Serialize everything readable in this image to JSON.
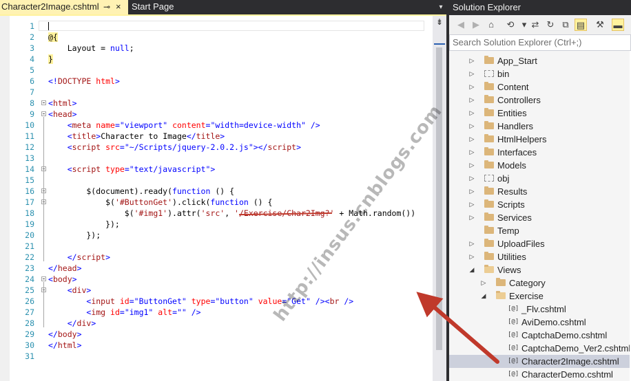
{
  "editor": {
    "tabs": [
      {
        "label": "Character2Image.cshtml",
        "pin": "⊸",
        "close": "×"
      },
      {
        "label": "Start Page"
      }
    ],
    "tab_menu": "▾",
    "split": "⇟"
  },
  "code": {
    "line_numbers": [
      "1",
      "2",
      "3",
      "4",
      "5",
      "6",
      "7",
      "8",
      "9",
      "10",
      "11",
      "12",
      "13",
      "14",
      "15",
      "16",
      "17",
      "18",
      "19",
      "20",
      "21",
      "22",
      "23",
      "24",
      "25",
      "26",
      "27",
      "28",
      "29",
      "30",
      "31"
    ],
    "lines": [
      [],
      [
        {
          "t": "@{",
          "c": "hl"
        }
      ],
      [
        {
          "t": "    Layout = ",
          "c": "black"
        },
        {
          "t": "null",
          "c": "blue"
        },
        {
          "t": ";",
          "c": "black"
        }
      ],
      [
        {
          "t": "}",
          "c": "hl"
        }
      ],
      [],
      [
        {
          "t": "<!",
          "c": "blue"
        },
        {
          "t": "DOCTYPE",
          "c": "maroon"
        },
        {
          "t": " ",
          "c": "black"
        },
        {
          "t": "html",
          "c": "red"
        },
        {
          "t": ">",
          "c": "blue"
        }
      ],
      [],
      [
        {
          "t": "<",
          "c": "blue"
        },
        {
          "t": "html",
          "c": "maroon"
        },
        {
          "t": ">",
          "c": "blue"
        }
      ],
      [
        {
          "t": "<",
          "c": "blue"
        },
        {
          "t": "head",
          "c": "maroon"
        },
        {
          "t": ">",
          "c": "blue"
        }
      ],
      [
        {
          "t": "    <",
          "c": "blue"
        },
        {
          "t": "meta",
          "c": "maroon"
        },
        {
          "t": " ",
          "c": "black"
        },
        {
          "t": "name",
          "c": "red"
        },
        {
          "t": "=\"viewport\" ",
          "c": "blue"
        },
        {
          "t": "content",
          "c": "red"
        },
        {
          "t": "=\"width=device-width\" />",
          "c": "blue"
        }
      ],
      [
        {
          "t": "    <",
          "c": "blue"
        },
        {
          "t": "title",
          "c": "maroon"
        },
        {
          "t": ">",
          "c": "blue"
        },
        {
          "t": "Character to Image",
          "c": "black"
        },
        {
          "t": "</",
          "c": "blue"
        },
        {
          "t": "title",
          "c": "maroon"
        },
        {
          "t": ">",
          "c": "blue"
        }
      ],
      [
        {
          "t": "    <",
          "c": "blue"
        },
        {
          "t": "script",
          "c": "maroon"
        },
        {
          "t": " ",
          "c": "black"
        },
        {
          "t": "src",
          "c": "red"
        },
        {
          "t": "=\"~/Scripts/jquery-2.0.2.js\"></",
          "c": "blue"
        },
        {
          "t": "script",
          "c": "maroon"
        },
        {
          "t": ">",
          "c": "blue"
        }
      ],
      [],
      [
        {
          "t": "    <",
          "c": "blue"
        },
        {
          "t": "script",
          "c": "maroon"
        },
        {
          "t": " ",
          "c": "black"
        },
        {
          "t": "type",
          "c": "red"
        },
        {
          "t": "=\"text/javascript\">",
          "c": "blue"
        }
      ],
      [],
      [
        {
          "t": "        $(document).ready(",
          "c": "black"
        },
        {
          "t": "function",
          "c": "blue"
        },
        {
          "t": " () {",
          "c": "black"
        }
      ],
      [
        {
          "t": "            $(",
          "c": "black"
        },
        {
          "t": "'#ButtonGet'",
          "c": "maroon"
        },
        {
          "t": ").click(",
          "c": "black"
        },
        {
          "t": "function",
          "c": "blue"
        },
        {
          "t": " () {",
          "c": "black"
        }
      ],
      [
        {
          "t": "                $(",
          "c": "black"
        },
        {
          "t": "'#img1'",
          "c": "maroon"
        },
        {
          "t": ").attr(",
          "c": "black"
        },
        {
          "t": "'src'",
          "c": "maroon"
        },
        {
          "t": ", ",
          "c": "black"
        },
        {
          "t": "'/Exercise/Char2Img?'",
          "c": "maroon"
        },
        {
          "t": " + Math.random())",
          "c": "black"
        }
      ],
      [
        {
          "t": "            });",
          "c": "black"
        }
      ],
      [
        {
          "t": "        });",
          "c": "black"
        }
      ],
      [],
      [
        {
          "t": "    </",
          "c": "blue"
        },
        {
          "t": "script",
          "c": "maroon"
        },
        {
          "t": ">",
          "c": "blue"
        }
      ],
      [
        {
          "t": "</",
          "c": "blue"
        },
        {
          "t": "head",
          "c": "maroon"
        },
        {
          "t": ">",
          "c": "blue"
        }
      ],
      [
        {
          "t": "<",
          "c": "blue"
        },
        {
          "t": "body",
          "c": "maroon"
        },
        {
          "t": ">",
          "c": "blue"
        }
      ],
      [
        {
          "t": "    <",
          "c": "blue"
        },
        {
          "t": "div",
          "c": "maroon"
        },
        {
          "t": ">",
          "c": "blue"
        }
      ],
      [
        {
          "t": "        <",
          "c": "blue"
        },
        {
          "t": "input",
          "c": "maroon"
        },
        {
          "t": " ",
          "c": "black"
        },
        {
          "t": "id",
          "c": "red"
        },
        {
          "t": "=\"ButtonGet\" ",
          "c": "blue"
        },
        {
          "t": "type",
          "c": "red"
        },
        {
          "t": "=\"button\" ",
          "c": "blue"
        },
        {
          "t": "value",
          "c": "red"
        },
        {
          "t": "=\"Get\" />",
          "c": "blue"
        },
        {
          "t": "<",
          "c": "blue"
        },
        {
          "t": "br",
          "c": "maroon"
        },
        {
          "t": " />",
          "c": "blue"
        }
      ],
      [
        {
          "t": "        <",
          "c": "blue"
        },
        {
          "t": "img",
          "c": "maroon"
        },
        {
          "t": " ",
          "c": "black"
        },
        {
          "t": "id",
          "c": "red"
        },
        {
          "t": "=\"img1\" ",
          "c": "blue"
        },
        {
          "t": "alt",
          "c": "red"
        },
        {
          "t": "=\"\" />",
          "c": "blue"
        }
      ],
      [
        {
          "t": "    </",
          "c": "blue"
        },
        {
          "t": "div",
          "c": "maroon"
        },
        {
          "t": ">",
          "c": "blue"
        }
      ],
      [
        {
          "t": "</",
          "c": "blue"
        },
        {
          "t": "body",
          "c": "maroon"
        },
        {
          "t": ">",
          "c": "blue"
        }
      ],
      [
        {
          "t": "</",
          "c": "blue"
        },
        {
          "t": "html",
          "c": "maroon"
        },
        {
          "t": ">",
          "c": "blue"
        }
      ],
      []
    ],
    "fold_lines": [
      8,
      9,
      14,
      16,
      17,
      24,
      25
    ]
  },
  "watermark": "http://insus.cnblogs.com",
  "solution_explorer": {
    "title": "Solution Explorer",
    "search_placeholder": "Search Solution Explorer (Ctrl+;)",
    "toolbar_icons": [
      {
        "name": "back-icon",
        "glyph": "◀",
        "state": "dim"
      },
      {
        "name": "forward-icon",
        "glyph": "▶",
        "state": "dim"
      },
      {
        "name": "home-icon",
        "glyph": "⌂",
        "state": ""
      },
      {
        "name": "history-icon",
        "glyph": "⟲",
        "state": ""
      },
      {
        "name": "dropdown-icon",
        "glyph": "▾",
        "state": ""
      },
      {
        "name": "sync-icon",
        "glyph": "⇄",
        "state": ""
      },
      {
        "name": "refresh-icon",
        "glyph": "↻",
        "state": ""
      },
      {
        "name": "collapse-all-icon",
        "glyph": "⧉",
        "state": ""
      },
      {
        "name": "show-all-files-icon",
        "glyph": "▤",
        "state": "on"
      },
      {
        "name": "properties-icon",
        "glyph": "⚒",
        "state": ""
      },
      {
        "name": "pin-icon",
        "glyph": "▬",
        "state": "on"
      }
    ],
    "tree": [
      {
        "label": "App_Start",
        "level": 0,
        "kind": "folder",
        "exp": "▷"
      },
      {
        "label": "bin",
        "level": 0,
        "kind": "dashed",
        "exp": "▷"
      },
      {
        "label": "Content",
        "level": 0,
        "kind": "folder",
        "exp": "▷"
      },
      {
        "label": "Controllers",
        "level": 0,
        "kind": "folder",
        "exp": "▷"
      },
      {
        "label": "Entities",
        "level": 0,
        "kind": "folder",
        "exp": "▷"
      },
      {
        "label": "Handlers",
        "level": 0,
        "kind": "folder",
        "exp": "▷"
      },
      {
        "label": "HtmlHelpers",
        "level": 0,
        "kind": "folder",
        "exp": "▷"
      },
      {
        "label": "Interfaces",
        "level": 0,
        "kind": "folder",
        "exp": "▷"
      },
      {
        "label": "Models",
        "level": 0,
        "kind": "folder",
        "exp": "▷"
      },
      {
        "label": "obj",
        "level": 0,
        "kind": "dashed",
        "exp": "▷"
      },
      {
        "label": "Results",
        "level": 0,
        "kind": "folder",
        "exp": "▷"
      },
      {
        "label": "Scripts",
        "level": 0,
        "kind": "folder",
        "exp": "▷"
      },
      {
        "label": "Services",
        "level": 0,
        "kind": "folder",
        "exp": "▷"
      },
      {
        "label": "Temp",
        "level": 0,
        "kind": "folder",
        "exp": ""
      },
      {
        "label": "UploadFiles",
        "level": 0,
        "kind": "folder",
        "exp": "▷"
      },
      {
        "label": "Utilities",
        "level": 0,
        "kind": "folder",
        "exp": "▷"
      },
      {
        "label": "Views",
        "level": 0,
        "kind": "open",
        "exp": "◢"
      },
      {
        "label": "Category",
        "level": 1,
        "kind": "folder",
        "exp": "▷"
      },
      {
        "label": "Exercise",
        "level": 1,
        "kind": "open",
        "exp": "◢"
      },
      {
        "label": "_Flv.cshtml",
        "level": 2,
        "kind": "file",
        "exp": ""
      },
      {
        "label": "AviDemo.cshtml",
        "level": 2,
        "kind": "file",
        "exp": ""
      },
      {
        "label": "CaptchaDemo.cshtml",
        "level": 2,
        "kind": "file",
        "exp": ""
      },
      {
        "label": "CaptchaDemo_Ver2.cshtml",
        "level": 2,
        "kind": "file",
        "exp": ""
      },
      {
        "label": "Character2Image.cshtml",
        "level": 2,
        "kind": "file",
        "exp": "",
        "selected": true
      },
      {
        "label": "CharacterDemo.cshtml",
        "level": 2,
        "kind": "file",
        "exp": ""
      }
    ],
    "file_glyph": "[@]"
  },
  "colors": {
    "keyword_blue": "#0000ff",
    "tag_maroon": "#a31515",
    "attr_red": "#ff0000",
    "line_number": "#2b91af",
    "razor_highlight": "#fff29d",
    "annotation_red": "#c0392b",
    "ide_dark": "#2d2d30"
  }
}
